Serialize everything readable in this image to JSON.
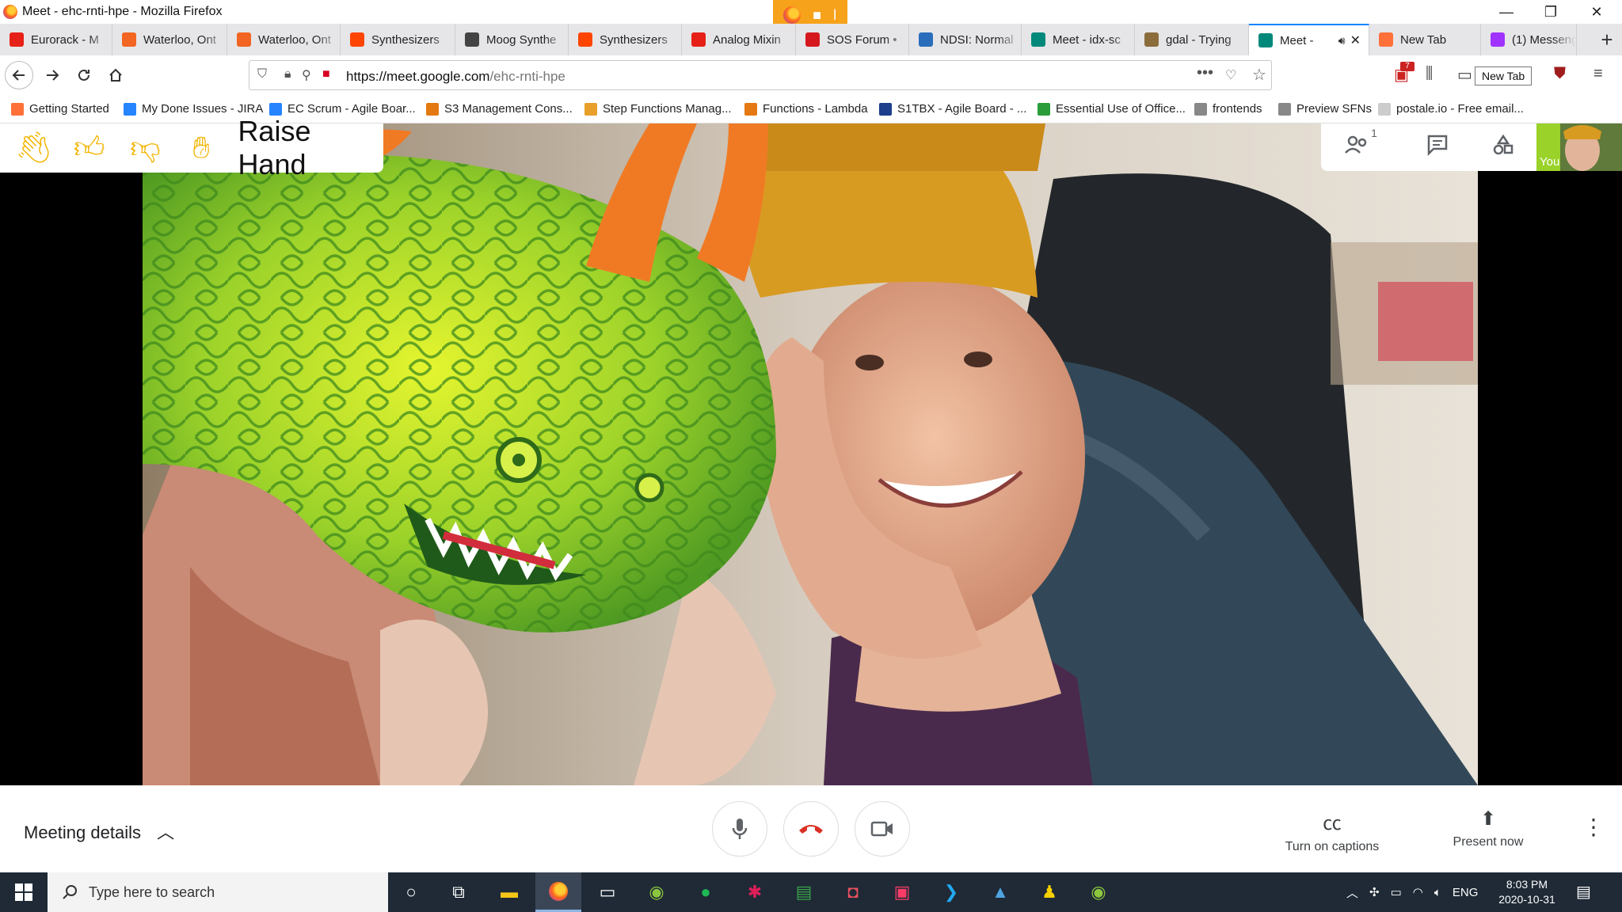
{
  "window": {
    "title": "Meet - ehc-rnti-hpe - Mozilla Firefox",
    "sharing_indicator": {
      "icons": [
        "firefox-icon",
        "camera-icon",
        "microphone-icon"
      ]
    }
  },
  "tabs": [
    {
      "label": "Eurorack - M",
      "fav_color": "#e62117"
    },
    {
      "label": "Waterloo, Ont",
      "fav_color": "#f26522"
    },
    {
      "label": "Waterloo, Ont",
      "fav_color": "#f26522"
    },
    {
      "label": "Synthesizers",
      "fav_color": "#ff4500"
    },
    {
      "label": "Moog Synthe",
      "fav_color": "#444444"
    },
    {
      "label": "Synthesizers",
      "fav_color": "#ff4500"
    },
    {
      "label": "Analog Mixin",
      "fav_color": "#e62117"
    },
    {
      "label": "SOS Forum •",
      "fav_color": "#d4181e"
    },
    {
      "label": "NDSI: Normal",
      "fav_color": "#2a6ebb"
    },
    {
      "label": "Meet - idx-sc",
      "fav_color": "#00897b"
    },
    {
      "label": "gdal - Trying",
      "fav_color": "#8a6d3b"
    },
    {
      "label": "Meet -",
      "fav_color": "#00897b",
      "active": true
    },
    {
      "label": "New Tab",
      "fav_color": "#ff7139"
    },
    {
      "label": "(1) Messenger",
      "fav_color": "#a033ff"
    }
  ],
  "nav": {
    "url_host": "https://meet.google.com",
    "url_path": "/ehc-rnti-hpe",
    "tooltip": "New Tab",
    "badge_count": "7"
  },
  "bookmarks": [
    {
      "label": "Getting Started",
      "color": "#ff7139"
    },
    {
      "label": "My Done Issues - JIRA",
      "color": "#2684ff"
    },
    {
      "label": "EC Scrum - Agile Boar...",
      "color": "#2684ff"
    },
    {
      "label": "S3 Management Cons...",
      "color": "#e47911"
    },
    {
      "label": "Step Functions Manag...",
      "color": "#e8a02b"
    },
    {
      "label": "Functions - Lambda",
      "color": "#e47911"
    },
    {
      "label": "S1TBX - Agile Board - ...",
      "color": "#1d3f8c"
    },
    {
      "label": "Essential Use of Office...",
      "color": "#2a9d3a"
    },
    {
      "label": "frontends",
      "color": "#888888"
    },
    {
      "label": "Preview SFNs",
      "color": "#888888"
    },
    {
      "label": "postale.io - Free email...",
      "color": "#cccccc"
    }
  ],
  "reactions": {
    "items": [
      "wave-icon",
      "thumbs-up-icon",
      "thumbs-down-icon"
    ],
    "raise_hand_label": "Raise Hand"
  },
  "meet_top": {
    "participants_count": "1",
    "self_label": "You"
  },
  "meet_bottom": {
    "details_label": "Meeting details",
    "captions_label": "Turn on captions",
    "present_label": "Present now"
  },
  "taskbar": {
    "search_placeholder": "Type here to search",
    "lang": "ENG",
    "time": "8:03 PM",
    "date": "2020-10-31"
  }
}
